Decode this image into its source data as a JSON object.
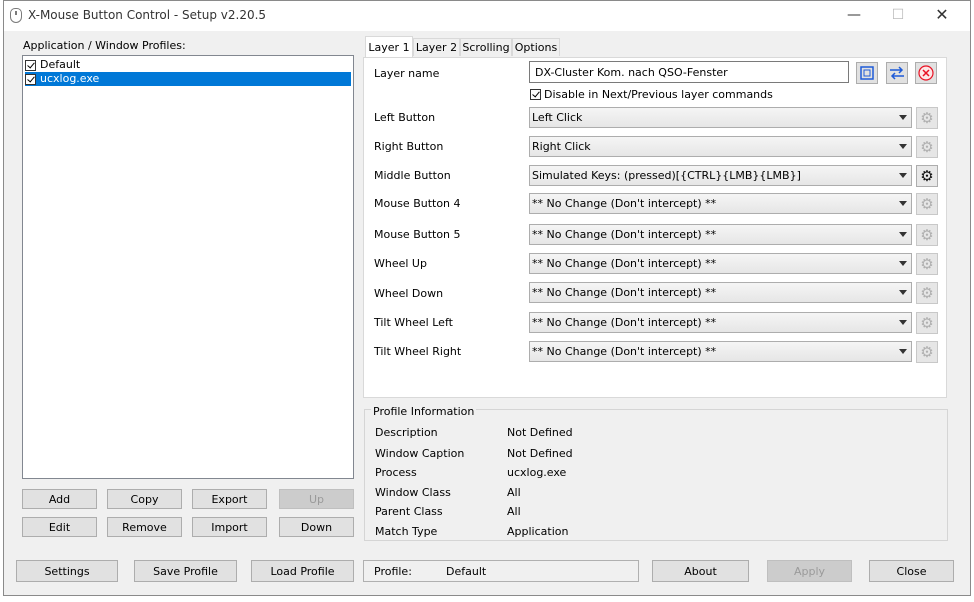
{
  "window": {
    "title": "X-Mouse Button Control - Setup v2.20.5",
    "minimize": "—",
    "maximize": "☐",
    "close": "✕"
  },
  "profiles": {
    "label": "Application / Window Profiles:",
    "items": [
      {
        "label": "Default",
        "checked": true,
        "selected": false
      },
      {
        "label": "ucxlog.exe",
        "checked": true,
        "selected": true
      }
    ]
  },
  "profile_buttons": {
    "add": "Add",
    "copy": "Copy",
    "export": "Export",
    "up": "Up",
    "edit": "Edit",
    "remove": "Remove",
    "import": "Import",
    "down": "Down"
  },
  "tabs": [
    "Layer 1",
    "Layer 2",
    "Scrolling",
    "Options"
  ],
  "layer": {
    "name_label": "Layer name",
    "name_value": "DX-Cluster Kom. nach QSO-Fenster",
    "disable_label": "Disable in Next/Previous layer commands",
    "disable_checked": true,
    "mappings": [
      {
        "label": "Left Button",
        "value": "Left Click",
        "gear_active": false
      },
      {
        "label": "Right Button",
        "value": "Right Click",
        "gear_active": false
      },
      {
        "label": "Middle Button",
        "value": "Simulated Keys: (pressed)[{CTRL}{LMB}{LMB}]",
        "gear_active": true
      },
      {
        "label": "Mouse Button 4",
        "value": "** No Change (Don't intercept) **",
        "gear_active": false
      },
      {
        "label": "Mouse Button 5",
        "value": "** No Change (Don't intercept) **",
        "gear_active": false
      },
      {
        "label": "Wheel Up",
        "value": "** No Change (Don't intercept) **",
        "gear_active": false
      },
      {
        "label": "Wheel Down",
        "value": "** No Change (Don't intercept) **",
        "gear_active": false
      },
      {
        "label": "Tilt Wheel Left",
        "value": "** No Change (Don't intercept) **",
        "gear_active": false
      },
      {
        "label": "Tilt Wheel Right",
        "value": "** No Change (Don't intercept) **",
        "gear_active": false
      }
    ]
  },
  "profile_info": {
    "title": "Profile Information",
    "rows": [
      {
        "label": "Description",
        "value": "Not Defined"
      },
      {
        "label": "Window Caption",
        "value": "Not Defined"
      },
      {
        "label": "Process",
        "value": "ucxlog.exe"
      },
      {
        "label": "Window Class",
        "value": "All"
      },
      {
        "label": "Parent Class",
        "value": "All"
      },
      {
        "label": "Match Type",
        "value": "Application"
      }
    ]
  },
  "footer": {
    "settings": "Settings",
    "save_profile": "Save Profile",
    "load_profile": "Load Profile",
    "profile_label": "Profile:",
    "profile_value": "Default",
    "about": "About",
    "apply": "Apply",
    "close": "Close"
  },
  "colors": {
    "selection": "#0078d7",
    "window_bg": "#f0f0f0",
    "delete_red": "#e81123",
    "swap_blue": "#1e5bd8"
  }
}
